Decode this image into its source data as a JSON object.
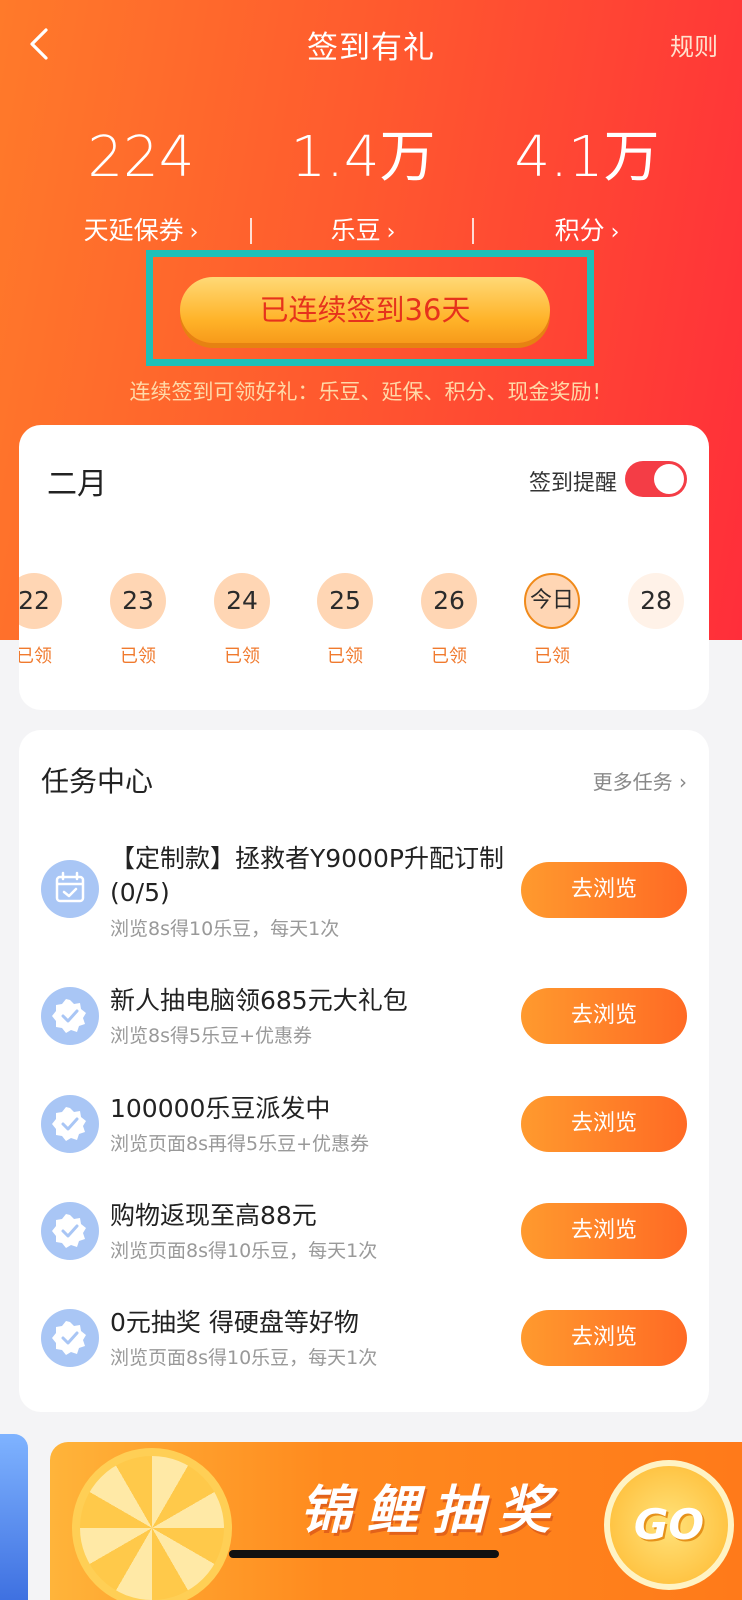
{
  "header": {
    "title": "签到有礼",
    "rules_label": "规则"
  },
  "stats": [
    {
      "value": "224",
      "label": "天延保券"
    },
    {
      "value": "1.4万",
      "label": "乐豆"
    },
    {
      "value": "4.1万",
      "label": "积分"
    }
  ],
  "stat_arrow": "›",
  "streak_button": "已连续签到36天",
  "hint": "连续签到可领好礼：乐豆、延保、积分、现金奖励！",
  "calendar": {
    "month": "二月",
    "remind_label": "签到提醒",
    "remind_on": true,
    "days": [
      {
        "label": "22",
        "status": "已领"
      },
      {
        "label": "23",
        "status": "已领"
      },
      {
        "label": "24",
        "status": "已领"
      },
      {
        "label": "25",
        "status": "已领"
      },
      {
        "label": "26",
        "status": "已领"
      },
      {
        "label": "今日",
        "status": "已领"
      },
      {
        "label": "28",
        "status": ""
      }
    ]
  },
  "tasks": {
    "title": "任务中心",
    "more_label": "更多任务 ›",
    "items": [
      {
        "name": "【定制款】拯救者Y9000P升配订制(0/5)",
        "desc": "浏览8s得10乐豆，每天1次",
        "button": "去浏览",
        "icon": "calendar-icon"
      },
      {
        "name": "新人抽电脑领685元大礼包",
        "desc": "浏览8s得5乐豆+优惠券",
        "button": "去浏览",
        "icon": "badge-check-icon"
      },
      {
        "name": "100000乐豆派发中",
        "desc": "浏览页面8s再得5乐豆+优惠券",
        "button": "去浏览",
        "icon": "badge-check-icon"
      },
      {
        "name": "购物返现至高88元",
        "desc": "浏览页面8s得10乐豆，每天1次",
        "button": "去浏览",
        "icon": "badge-check-icon"
      },
      {
        "name": "0元抽奖 得硬盘等好物",
        "desc": "浏览页面8s得10乐豆，每天1次",
        "button": "去浏览",
        "icon": "badge-check-icon"
      }
    ]
  },
  "banner": {
    "text": "锦鲤抽奖",
    "go_label": "GO"
  },
  "colors": {
    "accent": "#ff5a2e",
    "highlight_border": "#1ec0b8",
    "toggle_on": "#f43d46"
  }
}
